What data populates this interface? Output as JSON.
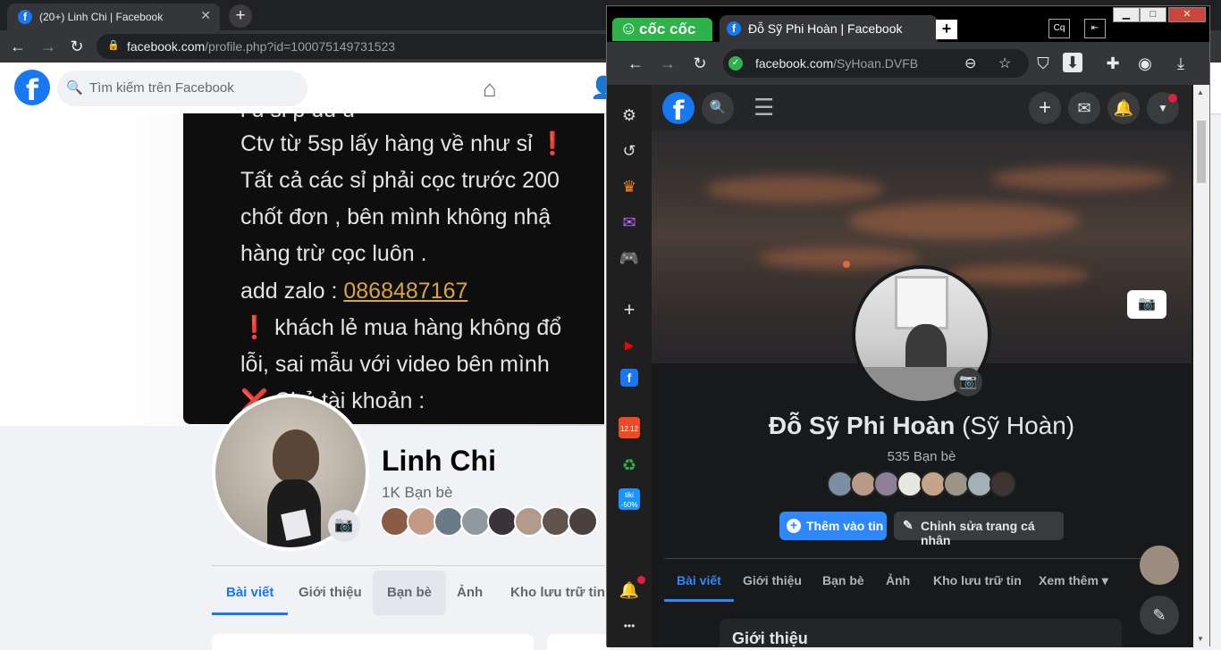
{
  "left": {
    "tab_title": "(20+) Linh Chi | Facebook",
    "tab_close": "✕",
    "new_tab": "+",
    "nav": {
      "back": "←",
      "forward": "→",
      "reload": "↻"
    },
    "url_host": "facebook.com",
    "url_path": "/profile.php?id=100075149731523",
    "search_placeholder": "Tìm kiếm trên Facebook",
    "icons": {
      "search": "🔍",
      "home": "⌂",
      "friends": "👤",
      "camera": "📷",
      "lock": "🔒"
    },
    "cover_lines": [
      "ỉ ủ sỉ p uu u",
      "Ctv từ 5sp lấy hàng về như sỉ  ❗",
      "Tất cả các sỉ phải cọc trước 200",
      "chốt đơn , bên mình không nhậ",
      "hàng trừ cọc luôn .",
      "add zalo : ",
      "❗ khách lẻ mua hàng không đổ",
      "lỗi, sai mẫu với video bên mình",
      "❌ Chủ tài khoản :"
    ],
    "zalo_number": "0868487167",
    "name": "Linh Chi",
    "friends_count": "1K Bạn bè",
    "tabs": [
      "Bài viết",
      "Giới thiệu",
      "Bạn bè",
      "Ảnh",
      "Kho lưu trữ tin"
    ]
  },
  "right": {
    "brand": "cốc cốc",
    "tab_title": "Đỗ Sỹ Phi Hoàn | Facebook",
    "new_tab": "+",
    "window_controls": {
      "minimize": "▁",
      "maximize": "□",
      "close": "✕"
    },
    "nav": {
      "back": "←",
      "forward": "→",
      "reload": "↻"
    },
    "url_host": "facebook.com",
    "url_path": "/SyHoan.DVFB",
    "toolbar_icons": {
      "zoom": "⊖",
      "star": "☆",
      "shield": "⛉",
      "download_box": "⬇",
      "extensions": "✚",
      "profile": "◉",
      "download": "⤓",
      "reader": "Cq",
      "sidebar": "⇤"
    },
    "sidebar_icons": {
      "settings": "⚙",
      "history": "↺",
      "crown": "♛",
      "messenger": "✉",
      "game": "🎮",
      "add": "+",
      "youtube": "▶",
      "facebook": "f",
      "sale": "12.12",
      "extra": "♻",
      "tiki": "tiki -50%",
      "bell": "🔔",
      "more": "•••"
    },
    "fb_icons": {
      "search": "🔍",
      "menu": "☰",
      "plus": "+",
      "messenger": "✉",
      "bell": "🔔",
      "caret": "▼",
      "camera": "📷",
      "edit": "✎",
      "compose": "✎"
    },
    "name": "Đỗ Sỹ Phi Hoàn",
    "nickname": "(Sỹ Hoàn)",
    "friends_count": "535 Bạn bè",
    "add_story": "Thêm vào tin",
    "edit_profile": "Chỉnh sửa trang cá nhân",
    "tabs": [
      "Bài viết",
      "Giới thiệu",
      "Bạn bè",
      "Ảnh",
      "Kho lưu trữ tin",
      "Xem thêm ▾"
    ],
    "intro_title": "Giới thiệu",
    "scroll_up": "▲",
    "scroll_down": "▼"
  },
  "colors": {
    "fb_blue": "#1877f2",
    "coccoc_green": "#2db34a",
    "dark_bg": "#18191a"
  }
}
